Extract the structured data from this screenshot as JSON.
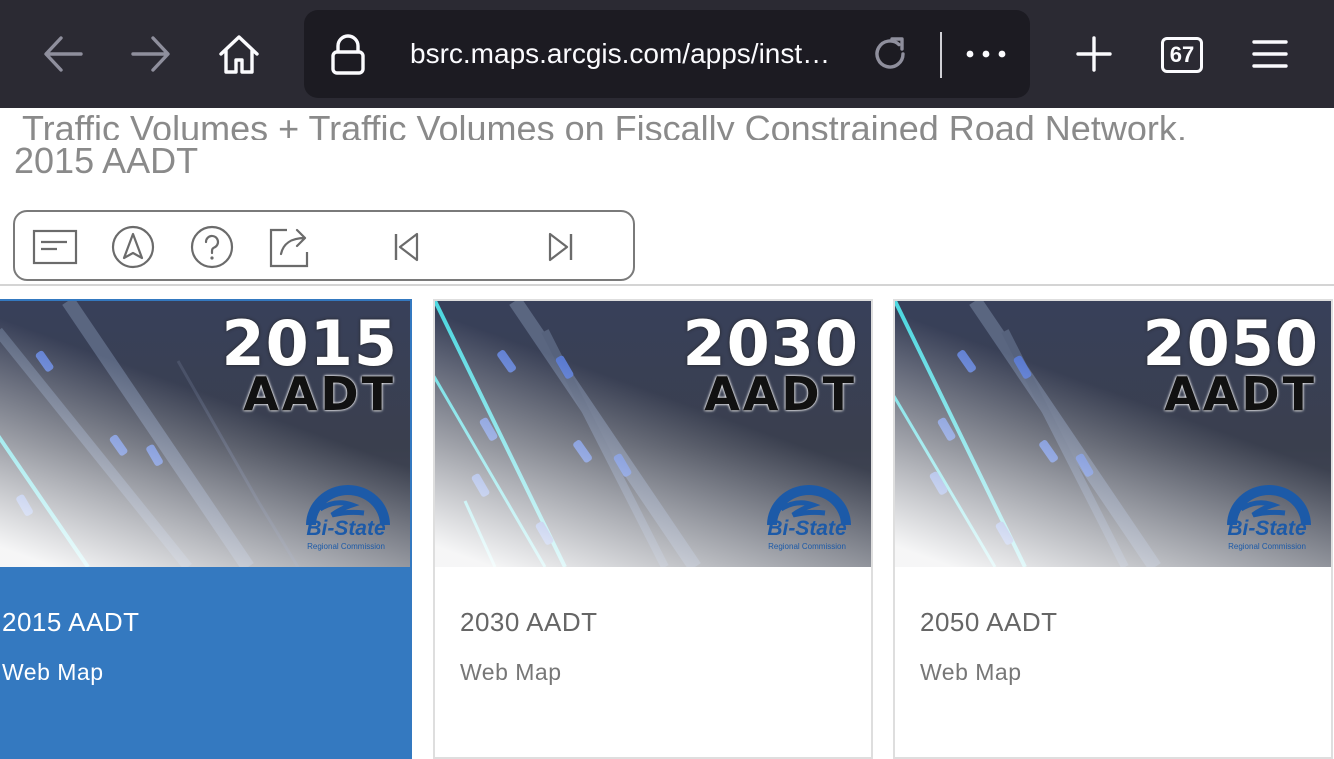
{
  "browser": {
    "url": "bsrc.maps.arcgis.com/apps/inst…",
    "tab_count": "67",
    "icons": [
      "back-icon",
      "forward-icon",
      "home-icon",
      "lock-icon",
      "reload-icon",
      "more-icon",
      "new-tab-icon",
      "tabs-icon",
      "menu-icon"
    ]
  },
  "page": {
    "title_line1": "Traffic Volumes + Traffic Volumes on Fiscally Constrained Road Network,",
    "title_line2": "2015 AADT"
  },
  "controls": {
    "icons": [
      "details-icon",
      "locate-icon",
      "help-icon",
      "share-icon",
      "first-item-icon",
      "last-item-icon"
    ]
  },
  "cards": [
    {
      "year": "2015",
      "badge": "AADT",
      "title": "2015 AADT",
      "type": "Web Map",
      "selected": true
    },
    {
      "year": "2030",
      "badge": "AADT",
      "title": "2030 AADT",
      "type": "Web Map",
      "selected": false
    },
    {
      "year": "2050",
      "badge": "AADT",
      "title": "2050 AADT",
      "type": "Web Map",
      "selected": false
    }
  ],
  "logo": {
    "name": "Bi-State",
    "subtitle": "Regional Commission",
    "color": "#1c5aa8"
  },
  "colors": {
    "toolbar": "#2b2a33",
    "urlbar": "#1c1b22",
    "selected": "#3479c0",
    "road_cyan": "#4fd8e0"
  }
}
